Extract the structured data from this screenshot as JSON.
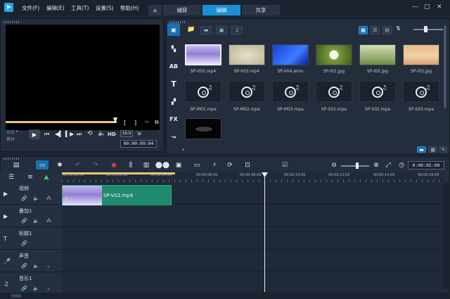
{
  "app": {
    "menus": [
      "文件(F)",
      "编辑(E)",
      "工具(T)",
      "设置(S)",
      "帮助(H)"
    ],
    "tabs": [
      "捕获",
      "编辑",
      "共享"
    ],
    "active_tab": "编辑"
  },
  "player": {
    "project_label": "项目",
    "clip_label": "素材",
    "hd_label": "HD",
    "aspect": "16:9",
    "timecode": "00:00:09:04"
  },
  "library": {
    "media": [
      {
        "name": "SP-V02.mp4",
        "kind": "video",
        "selected": true
      },
      {
        "name": "SP-V03.mp4",
        "kind": "video"
      },
      {
        "name": "SP-V04.wmv",
        "kind": "video"
      },
      {
        "name": "SP-I01.jpg",
        "kind": "image"
      },
      {
        "name": "SP-I02.jpg",
        "kind": "image"
      },
      {
        "name": "SP-I03.jpg",
        "kind": "image"
      },
      {
        "name": "SP-M01.mpa",
        "kind": "audio"
      },
      {
        "name": "SP-M02.mpa",
        "kind": "audio"
      },
      {
        "name": "SP-M03.mpa",
        "kind": "audio"
      },
      {
        "name": "SP-S01.mpa",
        "kind": "audio"
      },
      {
        "name": "SP-S02.mpa",
        "kind": "audio"
      },
      {
        "name": "SP-S03.mpa",
        "kind": "audio"
      }
    ],
    "side_tools": [
      "media-icon",
      "transition-icon",
      "title-icon",
      "graphic-icon",
      "filter-icon",
      "motion-icon"
    ],
    "fx_label": "FX",
    "colors": {
      "accent": "#1b8fd6",
      "clip": "#1f8a6e"
    }
  },
  "timeline": {
    "ruler": [
      "00:00:00:00",
      "00:00:02:00",
      "00:00:04:00",
      "00:00:06:00",
      "00:00:08:00",
      "00:00:10:00",
      "00:00:12:00",
      "00:00:14:00",
      "00:00:16:00"
    ],
    "duration": "0:00:05:00",
    "tracks": [
      {
        "name": "视频"
      },
      {
        "name": "叠加1"
      },
      {
        "name": "标题1"
      },
      {
        "name": "声音"
      },
      {
        "name": "音乐1"
      }
    ],
    "clip_label": "SP-V02.mp4"
  }
}
